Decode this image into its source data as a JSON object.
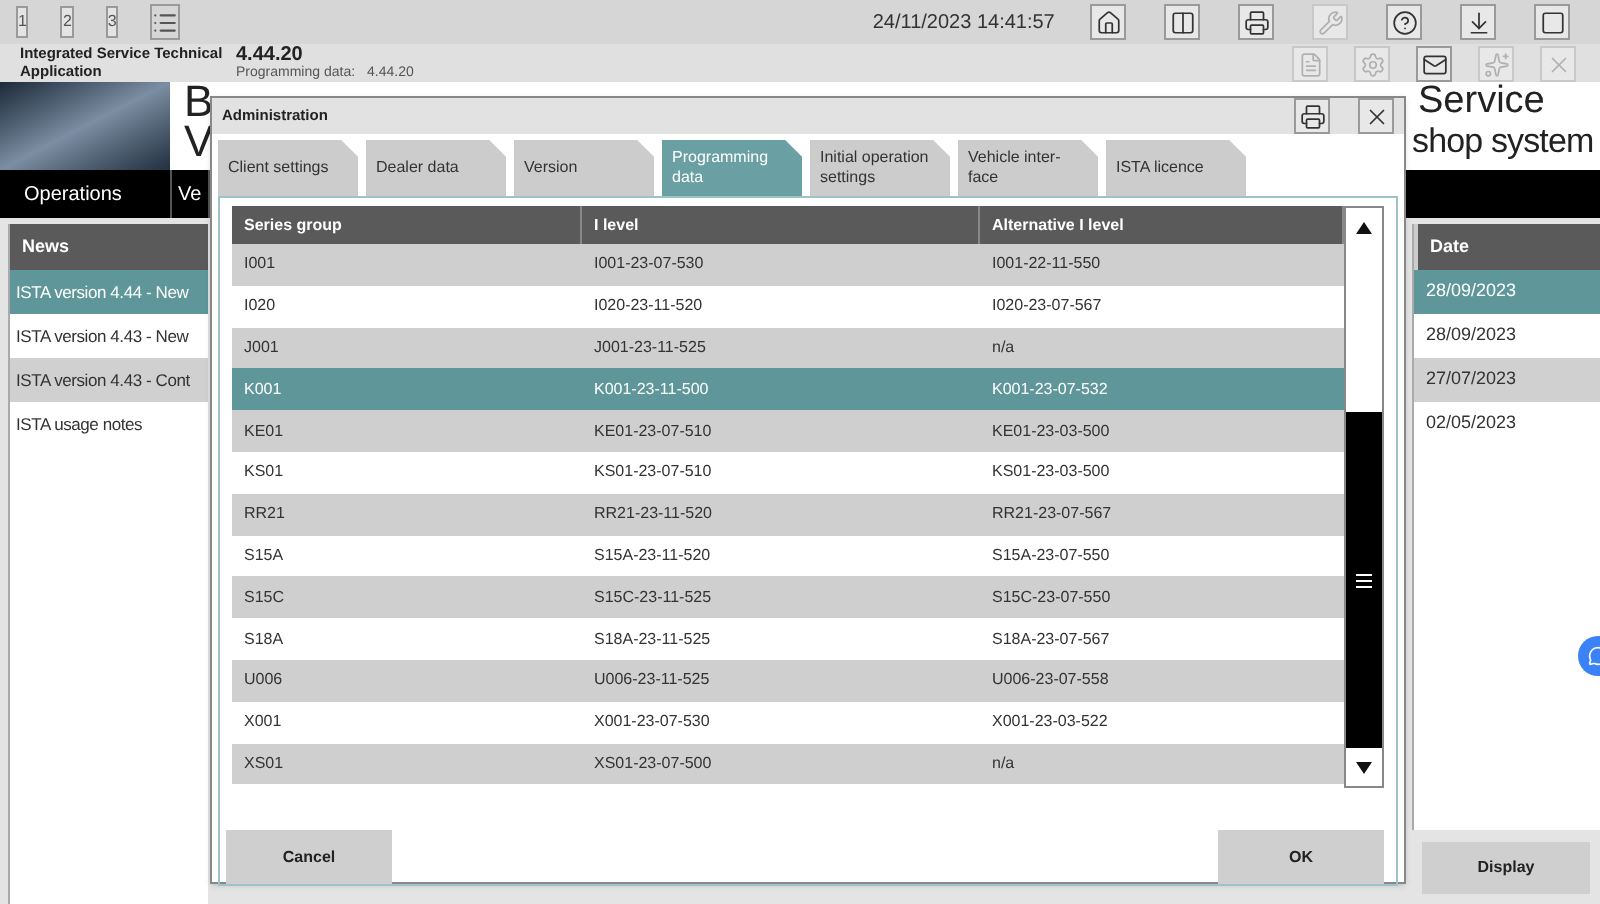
{
  "top_bar": {
    "buttons": [
      "1",
      "2",
      "3"
    ],
    "datetime": "24/11/2023 14:41:57"
  },
  "app_bar": {
    "title": "Integrated Service Technical Application",
    "version": "4.44.20",
    "programming_label": "Programming data:",
    "programming_version": "4.44.20"
  },
  "header": {
    "title_start": "B",
    "subtitle_start": "V",
    "title_end": "Service",
    "subtitle_end": "shop system"
  },
  "nav": {
    "items": [
      "Operations",
      "Ve"
    ]
  },
  "news": {
    "columns": [
      "News",
      "Date"
    ],
    "rows": [
      {
        "title": "ISTA version 4.44 - New",
        "date": "28/09/2023",
        "selected": true
      },
      {
        "title": "ISTA version 4.43 - New",
        "date": "28/09/2023",
        "selected": false
      },
      {
        "title": "ISTA version 4.43 - Cont",
        "date": "27/07/2023",
        "selected": false
      },
      {
        "title": "ISTA usage notes",
        "date": "02/05/2023",
        "selected": false
      }
    ],
    "display_button": "Display"
  },
  "dialog": {
    "title": "Administration",
    "tabs": [
      {
        "label": "Client settings",
        "selected": false
      },
      {
        "label": "Dealer data",
        "selected": false
      },
      {
        "label": "Version",
        "selected": false
      },
      {
        "label": "Programming data",
        "selected": true
      },
      {
        "label": "Initial operation settings",
        "selected": false
      },
      {
        "label": "Vehicle inter-\nface",
        "selected": false
      },
      {
        "label": "ISTA licence",
        "selected": false
      }
    ],
    "table": {
      "columns": [
        "Series group",
        "I level",
        "Alternative I level"
      ],
      "rows": [
        {
          "cells": [
            "I001",
            "I001-23-07-530",
            "I001-22-11-550"
          ],
          "selected": false
        },
        {
          "cells": [
            "I020",
            "I020-23-11-520",
            "I020-23-07-567"
          ],
          "selected": false
        },
        {
          "cells": [
            "J001",
            "J001-23-11-525",
            "n/a"
          ],
          "selected": false
        },
        {
          "cells": [
            "K001",
            "K001-23-11-500",
            "K001-23-07-532"
          ],
          "selected": true
        },
        {
          "cells": [
            "KE01",
            "KE01-23-07-510",
            "KE01-23-03-500"
          ],
          "selected": false
        },
        {
          "cells": [
            "KS01",
            "KS01-23-07-510",
            "KS01-23-03-500"
          ],
          "selected": false
        },
        {
          "cells": [
            "RR21",
            "RR21-23-11-520",
            "RR21-23-07-567"
          ],
          "selected": false
        },
        {
          "cells": [
            "S15A",
            "S15A-23-11-520",
            "S15A-23-07-550"
          ],
          "selected": false
        },
        {
          "cells": [
            "S15C",
            "S15C-23-11-525",
            "S15C-23-07-550"
          ],
          "selected": false
        },
        {
          "cells": [
            "S18A",
            "S18A-23-11-525",
            "S18A-23-07-567"
          ],
          "selected": false
        },
        {
          "cells": [
            "U006",
            "U006-23-11-525",
            "U006-23-07-558"
          ],
          "selected": false
        },
        {
          "cells": [
            "X001",
            "X001-23-07-530",
            "X001-23-03-522"
          ],
          "selected": false
        },
        {
          "cells": [
            "XS01",
            "XS01-23-07-500",
            "n/a"
          ],
          "selected": false
        }
      ]
    },
    "cancel_button": "Cancel",
    "ok_button": "OK"
  }
}
